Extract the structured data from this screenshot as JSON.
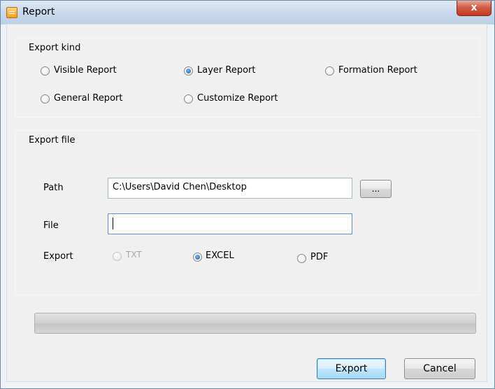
{
  "window": {
    "title": "Report",
    "close_glyph": "x",
    "icon": "report-app-icon"
  },
  "export_kind": {
    "label": "Export kind",
    "options": [
      {
        "label": "Visible Report",
        "selected": false
      },
      {
        "label": "Layer Report",
        "selected": true
      },
      {
        "label": "Formation Report",
        "selected": false
      },
      {
        "label": "General Report",
        "selected": false
      },
      {
        "label": "Customize Report",
        "selected": false
      }
    ]
  },
  "export_file": {
    "label": "Export file",
    "path": {
      "label": "Path",
      "value": "C:\\Users\\David Chen\\Desktop"
    },
    "browse_label": "...",
    "file": {
      "label": "File",
      "value": ""
    },
    "export": {
      "label": "Export",
      "options": [
        {
          "label": "TXT",
          "selected": false,
          "enabled": false
        },
        {
          "label": "EXCEL",
          "selected": true,
          "enabled": true
        },
        {
          "label": "PDF",
          "selected": false,
          "enabled": true
        }
      ]
    }
  },
  "progress": {
    "value": 0
  },
  "buttons": {
    "export": "Export",
    "cancel": "Cancel"
  },
  "colors": {
    "title_bar": "#c9d9ec",
    "close_button": "#c13a22",
    "default_button_border": "#3c7fb1"
  }
}
